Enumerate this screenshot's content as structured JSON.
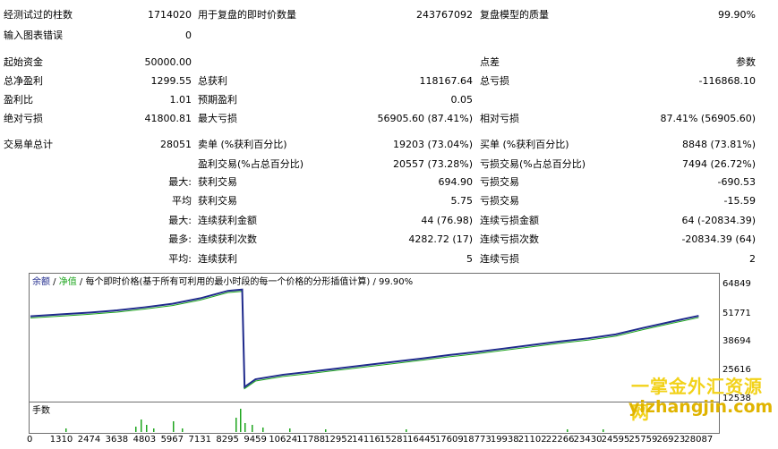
{
  "stats": {
    "r1": {
      "l1": "经测试过的柱数",
      "v1": "1714020",
      "l2": "用于复盘的即时价数量",
      "v2": "243767092",
      "l3": "复盘模型的质量",
      "v3": "99.90%"
    },
    "r2": {
      "l1": "输入图表错误",
      "v1": "0"
    },
    "r3": {
      "l1": "起始资金",
      "v1": "50000.00",
      "l3": "点差",
      "v3": "参数"
    },
    "r4": {
      "l1": "总净盈利",
      "v1": "1299.55",
      "l2": "总获利",
      "v2": "118167.64",
      "l3": "总亏损",
      "v3": "-116868.10"
    },
    "r5": {
      "l1": "盈利比",
      "v1": "1.01",
      "l2": "预期盈利",
      "v2": "0.05"
    },
    "r6": {
      "l1": "绝对亏损",
      "v1": "41800.81",
      "l2": "最大亏损",
      "v2": "56905.60 (87.41%)",
      "l3": "相对亏损",
      "v3": "87.41% (56905.60)"
    },
    "r7": {
      "l1": "交易单总计",
      "v1": "28051",
      "l2": "卖单 (%获利百分比)",
      "v2": "19203 (73.04%)",
      "l3": "买单 (%获利百分比)",
      "v3": "8848 (73.81%)"
    },
    "r8": {
      "l2": "盈利交易(%占总百分比)",
      "v2": "20557 (73.28%)",
      "l3": "亏损交易(%占总百分比)",
      "v3": "7494 (26.72%)"
    },
    "r9": {
      "p": "最大:",
      "l2": "获利交易",
      "v2": "694.90",
      "l3": "亏损交易",
      "v3": "-690.53"
    },
    "r10": {
      "p": "平均",
      "l2": "获利交易",
      "v2": "5.75",
      "l3": "亏损交易",
      "v3": "-15.59"
    },
    "r11": {
      "p": "最大:",
      "l2": "连续获利金额",
      "v2": "44 (76.98)",
      "l3": "连续亏损金额",
      "v3": "64 (-20834.39)"
    },
    "r12": {
      "p": "最多:",
      "l2": "连续获利次数",
      "v2": "4282.72 (17)",
      "l3": "连续亏损次数",
      "v3": "-20834.39 (64)"
    },
    "r13": {
      "p": "平均:",
      "l2": "连续获利",
      "v2": "5",
      "l3": "连续亏损",
      "v3": "2"
    }
  },
  "chart": {
    "legend_balance": "余额",
    "legend_separator": " / ",
    "legend_equity": "净值",
    "legend_rest": " / 每个即时价格(基于所有可利用的最小时段的每一个价格的分形插值计算) / 99.90%",
    "volume_label": "手数",
    "colors": {
      "balance": "#1f2a8c",
      "equity": "#1ea51e",
      "volume": "#1ea51e",
      "legend_equity": "#1ea51e"
    }
  },
  "chart_data": {
    "type": "line",
    "series": [
      {
        "name": "余额",
        "x": [
          0,
          1310,
          2474,
          3638,
          4803,
          5967,
          7131,
          8295,
          8900,
          9000,
          9459,
          10624,
          11788,
          12952,
          14116,
          15281,
          16445,
          17609,
          18773,
          19938,
          21102,
          22266,
          23430,
          24595,
          25759,
          26923,
          28087
        ],
        "values": [
          50300,
          51200,
          52000,
          53000,
          54400,
          56000,
          58500,
          61900,
          62500,
          18000,
          21500,
          23600,
          25000,
          26500,
          28000,
          29500,
          31000,
          32600,
          34000,
          35600,
          37200,
          38800,
          40200,
          42000,
          45000,
          47800,
          50500
        ]
      }
    ],
    "y_ticks": [
      "64849",
      "51771",
      "38694",
      "25616",
      "12538"
    ],
    "x_ticks": [
      "0",
      "1310",
      "2474",
      "3638",
      "4803",
      "5967",
      "7131",
      "8295",
      "9459",
      "10624",
      "11788",
      "12952",
      "14116",
      "15281",
      "16445",
      "17609",
      "18773",
      "19938",
      "21102",
      "22266",
      "23430",
      "24595",
      "25759",
      "26923",
      "28087"
    ]
  },
  "watermark": {
    "line1": "一掌金外汇资源网",
    "line2": "yizhangjin.com"
  }
}
